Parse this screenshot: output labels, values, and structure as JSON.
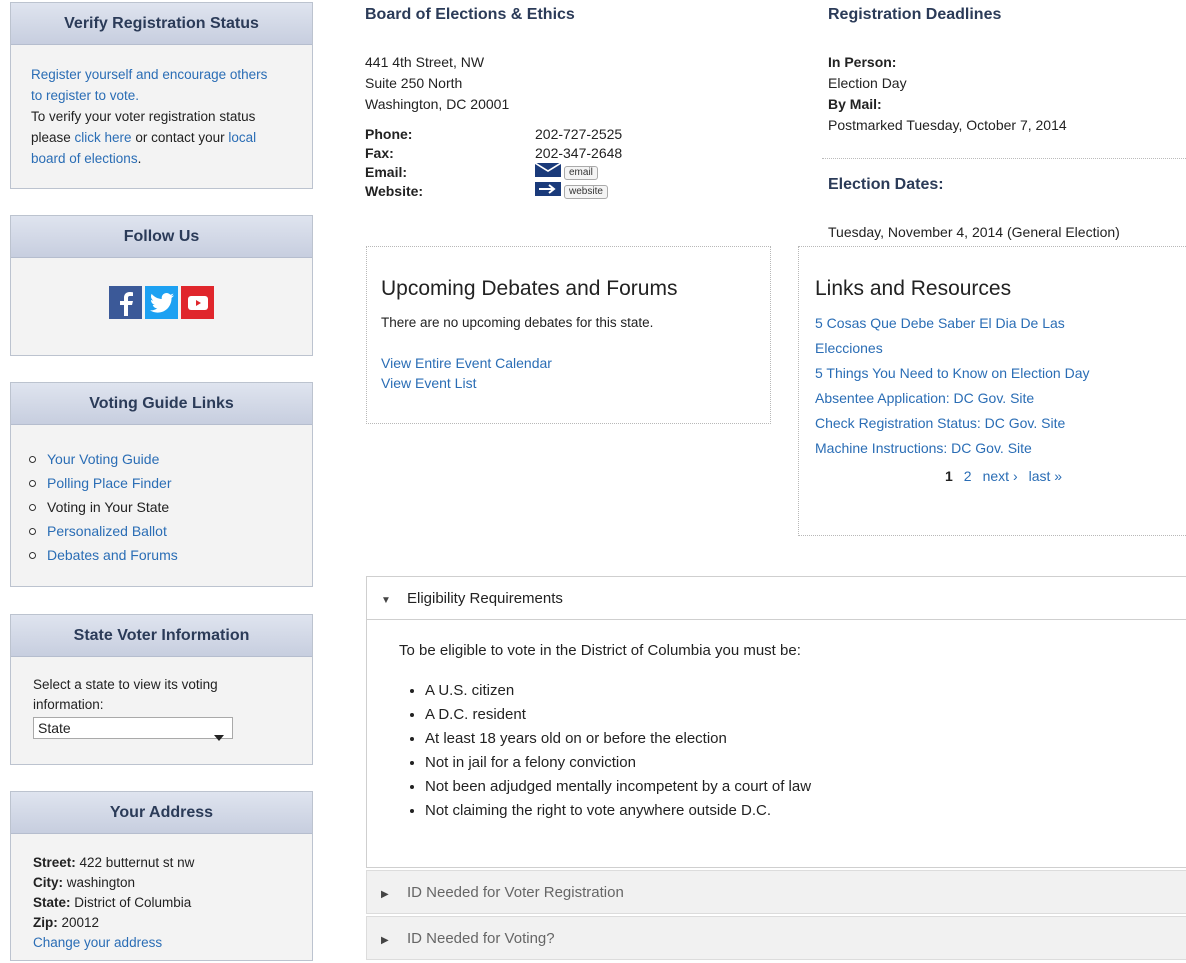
{
  "sidebar": {
    "verify": {
      "title": "Verify Registration Status",
      "link1": "Register yourself and encourage others to register to vote.",
      "text1": "To verify your voter registration status please ",
      "link2": "click here",
      "text2": " or contact your ",
      "link3": "local board of elections",
      "text3": "."
    },
    "follow": {
      "title": "Follow Us",
      "icons": [
        "facebook-icon",
        "twitter-icon",
        "youtube-icon"
      ]
    },
    "guide": {
      "title": "Voting Guide Links",
      "items": [
        {
          "label": "Your Voting Guide",
          "link": true
        },
        {
          "label": "Polling Place Finder",
          "link": true
        },
        {
          "label": "Voting in Your State",
          "link": false
        },
        {
          "label": "Personalized Ballot",
          "link": true
        },
        {
          "label": "Debates and Forums",
          "link": true
        }
      ]
    },
    "state_info": {
      "title": "State Voter Information",
      "prompt": "Select a state to view its voting information:",
      "selected": "State"
    },
    "address": {
      "title": "Your Address",
      "street_label": "Street:",
      "street": "422 butternut st nw",
      "city_label": "City:",
      "city": "washington",
      "state_label": "State:",
      "state": "District of Columbia",
      "zip_label": "Zip:",
      "zip": "20012",
      "change_link": "Change your address"
    }
  },
  "board": {
    "title": "Board of Elections & Ethics",
    "address_lines": [
      "441 4th Street, NW",
      "Suite 250 North",
      "Washington, DC 20001"
    ],
    "phone_label": "Phone:",
    "phone": "202-727-2525",
    "fax_label": "Fax:",
    "fax": "202-347-2648",
    "email_label": "Email:",
    "email_tag": "email",
    "website_label": "Website:",
    "website_tag": "website"
  },
  "deadlines": {
    "title": "Registration Deadlines",
    "in_person_label": "In Person:",
    "in_person": "Election Day",
    "by_mail_label": "By Mail:",
    "by_mail": "Postmarked Tuesday, October 7, 2014",
    "dates_title": "Election Dates:",
    "dates": "Tuesday, November 4, 2014 (General Election)"
  },
  "debates": {
    "title": "Upcoming Debates and Forums",
    "message": "There are no upcoming debates for this state.",
    "calendar_link": "View Entire Event Calendar",
    "list_link": "View Event List"
  },
  "resources": {
    "title": "Links and Resources",
    "links": [
      "5 Cosas Que Debe Saber El Dia De Las Elecciones",
      "5 Things You Need to Know on Election Day",
      "Absentee Application: DC Gov. Site",
      "Check Registration Status: DC Gov. Site",
      "Machine Instructions: DC Gov. Site"
    ],
    "pager": {
      "current": "1",
      "page2": "2",
      "next": "next ›",
      "last": "last »"
    }
  },
  "accordion": {
    "eligibility": {
      "title": "Eligibility Requirements",
      "intro": "To be eligible to vote in the District of Columbia you must be:",
      "items": [
        "A U.S. citizen",
        "A D.C. resident",
        "At least 18 years old on or before the election",
        "Not in jail for a felony conviction",
        "Not been adjudged mentally incompetent by a court of law",
        "Not claiming the right to vote anywhere outside D.C."
      ]
    },
    "id_registration": "ID Needed for Voter Registration",
    "id_voting": "ID Needed for Voting?"
  },
  "colors": {
    "link": "#2a6db5",
    "header_text": "#2b3b58",
    "facebook": "#3b5998",
    "twitter": "#1da1f2",
    "youtube": "#e0262c"
  }
}
